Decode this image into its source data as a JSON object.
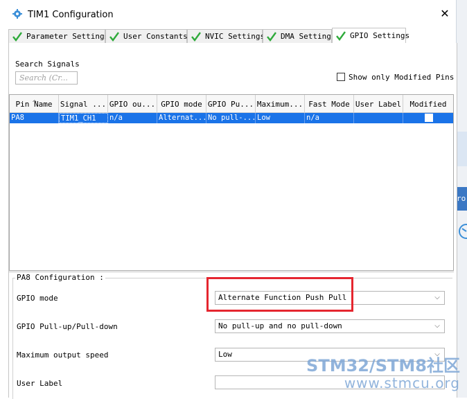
{
  "window": {
    "title": "TIM1 Configuration"
  },
  "tabs": [
    {
      "label": "Parameter Settings",
      "active": false
    },
    {
      "label": "User Constants",
      "active": false
    },
    {
      "label": "NVIC Settings",
      "active": false
    },
    {
      "label": "DMA Settings",
      "active": false
    },
    {
      "label": "GPIO Settings",
      "active": true
    }
  ],
  "search": {
    "label": "Search Signals",
    "placeholder": "Search (Cr..."
  },
  "show_modified": {
    "label": "Show only Modified Pins",
    "checked": false
  },
  "table": {
    "headers": [
      "Pin Name",
      "Signal ...",
      "GPIO ou...",
      "GPIO mode",
      "GPIO Pu...",
      "Maximum...",
      "Fast Mode",
      "User Label",
      "Modified"
    ],
    "rows": [
      {
        "cells": [
          "PA8",
          "TIM1_CH1",
          "n/a",
          "Alternat...",
          "No pull-...",
          "Low",
          "n/a",
          "",
          ""
        ],
        "selected": true,
        "modified": false
      }
    ]
  },
  "config": {
    "title": "PA8 Configuration :",
    "gpio_mode_label": "GPIO mode",
    "gpio_mode_value": "Alternate Function Push Pull",
    "pull_label": "GPIO Pull-up/Pull-down",
    "pull_value": "No pull-up and no pull-down",
    "speed_label": "Maximum output speed",
    "speed_value": "Low",
    "user_label_label": "User Label",
    "user_label_value": ""
  },
  "side": {
    "peek_text": "ro"
  },
  "watermark": {
    "line1": "STM32/STM8社区",
    "line2": "www.stmcu.org"
  },
  "colors": {
    "selection": "#1a73e8",
    "highlight_box": "#e5262f",
    "check_green": "#2eaa3a"
  }
}
